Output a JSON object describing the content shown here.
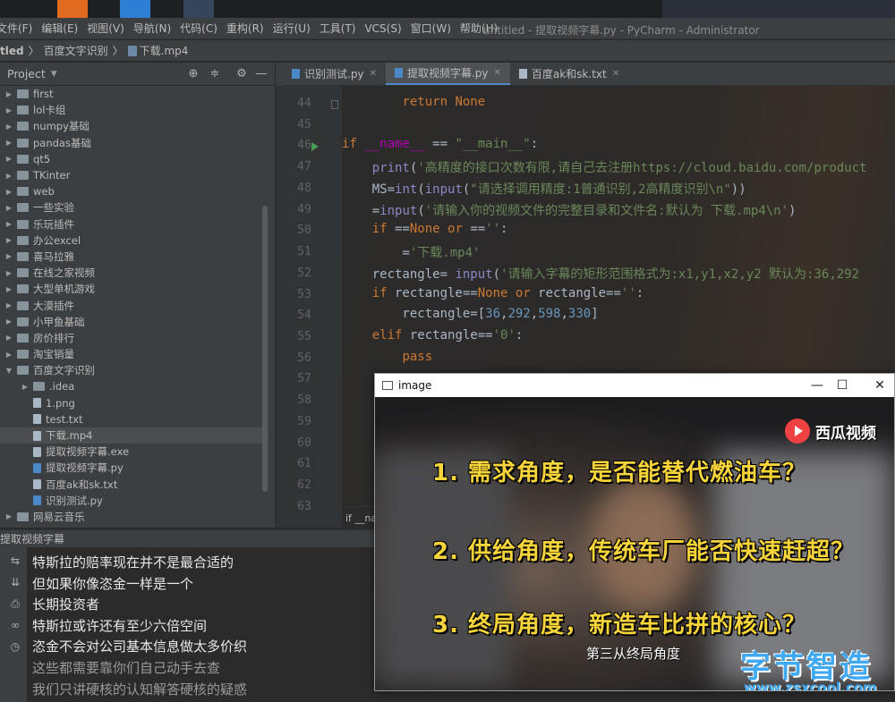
{
  "menubar": {
    "items": [
      "文件(F)",
      "编辑(E)",
      "视图(V)",
      "导航(N)",
      "代码(C)",
      "重构(R)",
      "运行(U)",
      "工具(T)",
      "VCS(S)",
      "窗口(W)",
      "帮助(H)"
    ],
    "window_title": "untitled - 提取视频字幕.py - PyCharm - Administrator"
  },
  "breadcrumb": {
    "items": [
      "tled",
      "百度文字识别",
      "下载.mp4"
    ]
  },
  "project_panel": {
    "title": "Project",
    "tree": [
      {
        "label": "first",
        "type": "folder",
        "level": 0,
        "expanded": false
      },
      {
        "label": "lol卡组",
        "type": "folder",
        "level": 0,
        "expanded": false
      },
      {
        "label": "numpy基础",
        "type": "folder",
        "level": 0,
        "expanded": false
      },
      {
        "label": "pandas基础",
        "type": "folder",
        "level": 0,
        "expanded": false
      },
      {
        "label": "qt5",
        "type": "folder",
        "level": 0,
        "expanded": false
      },
      {
        "label": "TKinter",
        "type": "folder",
        "level": 0,
        "expanded": false
      },
      {
        "label": "web",
        "type": "folder",
        "level": 0,
        "expanded": false
      },
      {
        "label": "一些实验",
        "type": "folder",
        "level": 0,
        "expanded": false
      },
      {
        "label": "乐玩插件",
        "type": "folder",
        "level": 0,
        "expanded": false
      },
      {
        "label": "办公excel",
        "type": "folder",
        "level": 0,
        "expanded": false
      },
      {
        "label": "喜马拉雅",
        "type": "folder",
        "level": 0,
        "expanded": false
      },
      {
        "label": "在线之家视频",
        "type": "folder",
        "level": 0,
        "expanded": false
      },
      {
        "label": "大型单机游戏",
        "type": "folder",
        "level": 0,
        "expanded": false
      },
      {
        "label": "大漠插件",
        "type": "folder",
        "level": 0,
        "expanded": false
      },
      {
        "label": "小甲鱼基础",
        "type": "folder",
        "level": 0,
        "expanded": false
      },
      {
        "label": "房价排行",
        "type": "folder",
        "level": 0,
        "expanded": false
      },
      {
        "label": "淘宝销量",
        "type": "folder",
        "level": 0,
        "expanded": false
      },
      {
        "label": "百度文字识别",
        "type": "folder",
        "level": 0,
        "expanded": true
      },
      {
        "label": ".idea",
        "type": "folder",
        "level": 1,
        "expanded": false
      },
      {
        "label": "1.png",
        "type": "file",
        "level": 1
      },
      {
        "label": "test.txt",
        "type": "file",
        "level": 1
      },
      {
        "label": "下载.mp4",
        "type": "file",
        "level": 1,
        "selected": true
      },
      {
        "label": "提取视频字幕.exe",
        "type": "file",
        "level": 1
      },
      {
        "label": "提取视频字幕.py",
        "type": "py",
        "level": 1
      },
      {
        "label": "百度ak和sk.txt",
        "type": "file",
        "level": 1
      },
      {
        "label": "识别测试.py",
        "type": "py",
        "level": 1
      },
      {
        "label": "网易云音乐",
        "type": "folder",
        "level": 0,
        "expanded": false
      }
    ]
  },
  "editor": {
    "tabs": [
      {
        "label": "识别测试.py",
        "active": false
      },
      {
        "label": "提取视频字幕.py",
        "active": true
      },
      {
        "label": "百度ak和sk.txt",
        "active": false
      }
    ],
    "line_numbers": [
      "44",
      "45",
      "46",
      "47",
      "48",
      "49",
      "50",
      "51",
      "52",
      "53",
      "54",
      "55",
      "56",
      "57",
      "58",
      "59",
      "60",
      "61",
      "62",
      "63"
    ],
    "code_lines": [
      "        return None",
      "",
      "if __name__ == \"__main__\":",
      "    print('高精度的接口次数有限,请自己去注册https://cloud.baidu.com/product",
      "    MS=int(input(\"请选择调用精度:1普通识别,2高精度识别\\n\"))",
      "    mp4Name=input('请输入你的视频文件的完整目录和文件名:默认为 下载.mp4\\n')",
      "    if mp4Name==None or mp4Name=='':",
      "        mp4Name='下载.mp4'",
      "    rectangle= input('请输入字幕的矩形范围格式为:x1,y1,x2,y2 默认为:36,292",
      "    if rectangle==None or rectangle=='':",
      "        rectangle=[36,292,598,330]",
      "    elif rectangle=='0':",
      "        pass"
    ],
    "bottom_crumb": "if __na"
  },
  "run_panel": {
    "title": "提取视频字幕",
    "output": [
      "特斯拉的赔率现在并不是最合适的",
      "但如果你像恣金一样是一个",
      "长期投资者",
      "特斯拉或许还有至少六倍空间",
      "恣金不会对公司基本信息做太多价织",
      "这些都需要靠你们自己动手去查",
      "我们只讲硬核的认知解答硬核的疑惑"
    ]
  },
  "image_window": {
    "title": "image",
    "subtitles": [
      "1. 需求角度，是否能替代燃油车？",
      "2. 供给角度，传统车厂能否快速赶超？",
      "3. 终局角度，新造车比拼的核心？"
    ],
    "caption": "第三从终局角度",
    "brand": "西瓜视频",
    "watermark_text": "字节智造",
    "watermark_url": "www.zsxcool.com"
  },
  "colors": {
    "keyword": "#cc7832",
    "string": "#6a8759",
    "number": "#6897bb",
    "subtitle_yellow": "#f7d43a",
    "watermark_blue": "#3fa9f5"
  }
}
